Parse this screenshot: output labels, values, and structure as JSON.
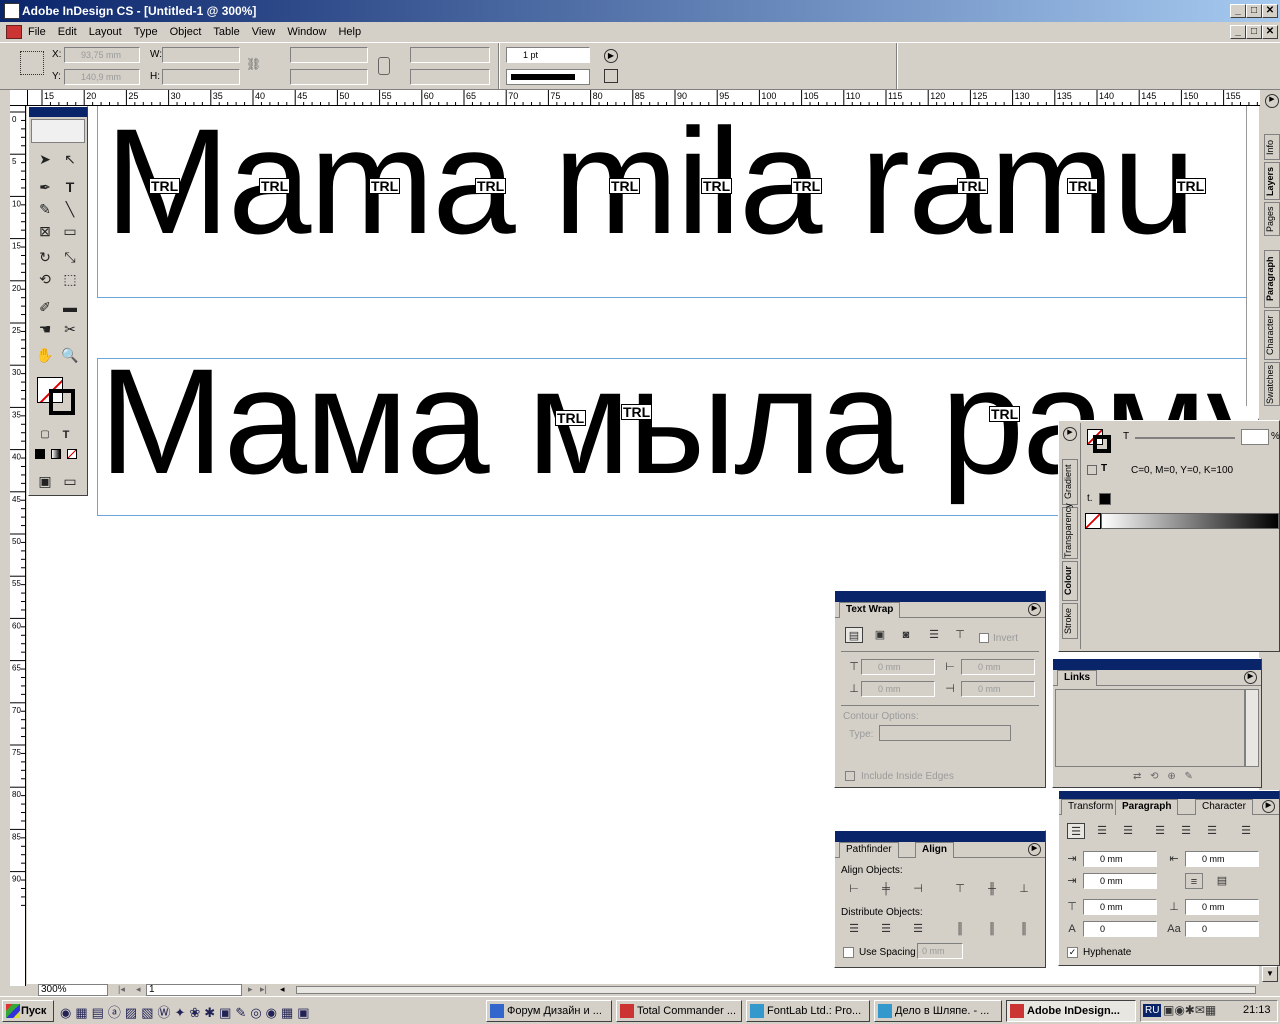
{
  "window": {
    "title": "Adobe InDesign CS - [Untitled-1 @ 300%]",
    "min_label": "_",
    "max_label": "□",
    "close_label": "✕"
  },
  "menu": [
    "File",
    "Edit",
    "Layout",
    "Type",
    "Object",
    "Table",
    "View",
    "Window",
    "Help"
  ],
  "control": {
    "x_label": "X:",
    "x_value": "93,75 mm",
    "y_label": "Y:",
    "y_value": "140,9 mm",
    "w_label": "W:",
    "h_label": "H:",
    "stroke_weight": "1 pt"
  },
  "ruler_h": [
    "15",
    "20",
    "25",
    "30",
    "35",
    "40",
    "45",
    "50",
    "55",
    "60",
    "65",
    "70",
    "75",
    "80",
    "85",
    "90",
    "95",
    "100",
    "105",
    "110",
    "115",
    "120",
    "125",
    "130",
    "135",
    "140",
    "145",
    "150",
    "155"
  ],
  "ruler_v": [
    "0",
    "5",
    "10",
    "15",
    "20",
    "25",
    "30",
    "35",
    "40",
    "45",
    "50",
    "55",
    "60",
    "65",
    "70",
    "75",
    "80",
    "85",
    "90"
  ],
  "document": {
    "line1": "Mama mila ramu",
    "line2": "Мама мыла раму",
    "tracking_marker": "TRL"
  },
  "color_panel": {
    "tabs": [
      "Gradient",
      "Transparency",
      "Colour",
      "Stroke"
    ],
    "tint_label": "T",
    "tint_unit": "%",
    "cmyk": "C=0, M=0, Y=0, K=100"
  },
  "side_tabs": [
    "Info",
    "Layers",
    "Pages",
    "Paragraph",
    "Character",
    "Swatches"
  ],
  "text_wrap": {
    "title": "Text Wrap",
    "invert": "Invert",
    "top": "0 mm",
    "left": "0 mm",
    "bottom": "0 mm",
    "right": "0 mm",
    "contour_options": "Contour Options:",
    "type_label": "Type:",
    "include_inside": "Include Inside Edges"
  },
  "links": {
    "title": "Links"
  },
  "paragraph": {
    "tabs": [
      "Transform",
      "Paragraph",
      "Character"
    ],
    "left_indent": "0 mm",
    "right_indent": "0 mm",
    "first_line": "0 mm",
    "last_line": "",
    "space_before": "0 mm",
    "space_after": "0 mm",
    "drop_lines": "0",
    "drop_chars": "0",
    "hyphenate": "Hyphenate"
  },
  "align": {
    "tabs": [
      "Pathfinder",
      "Align"
    ],
    "align_objects": "Align Objects:",
    "distribute_objects": "Distribute Objects:",
    "use_spacing": "Use Spacing",
    "spacing_value": "0 mm"
  },
  "status": {
    "zoom": "300%",
    "page": "1"
  },
  "taskbar": {
    "start": "Пуск",
    "tasks": [
      "Форум Дизайн и ...",
      "Total Commander ...",
      "FontLab Ltd.: Pro...",
      "Дело в Шляпе. - ...",
      "Adobe InDesign..."
    ],
    "lang": "RU",
    "clock": "21:13"
  }
}
